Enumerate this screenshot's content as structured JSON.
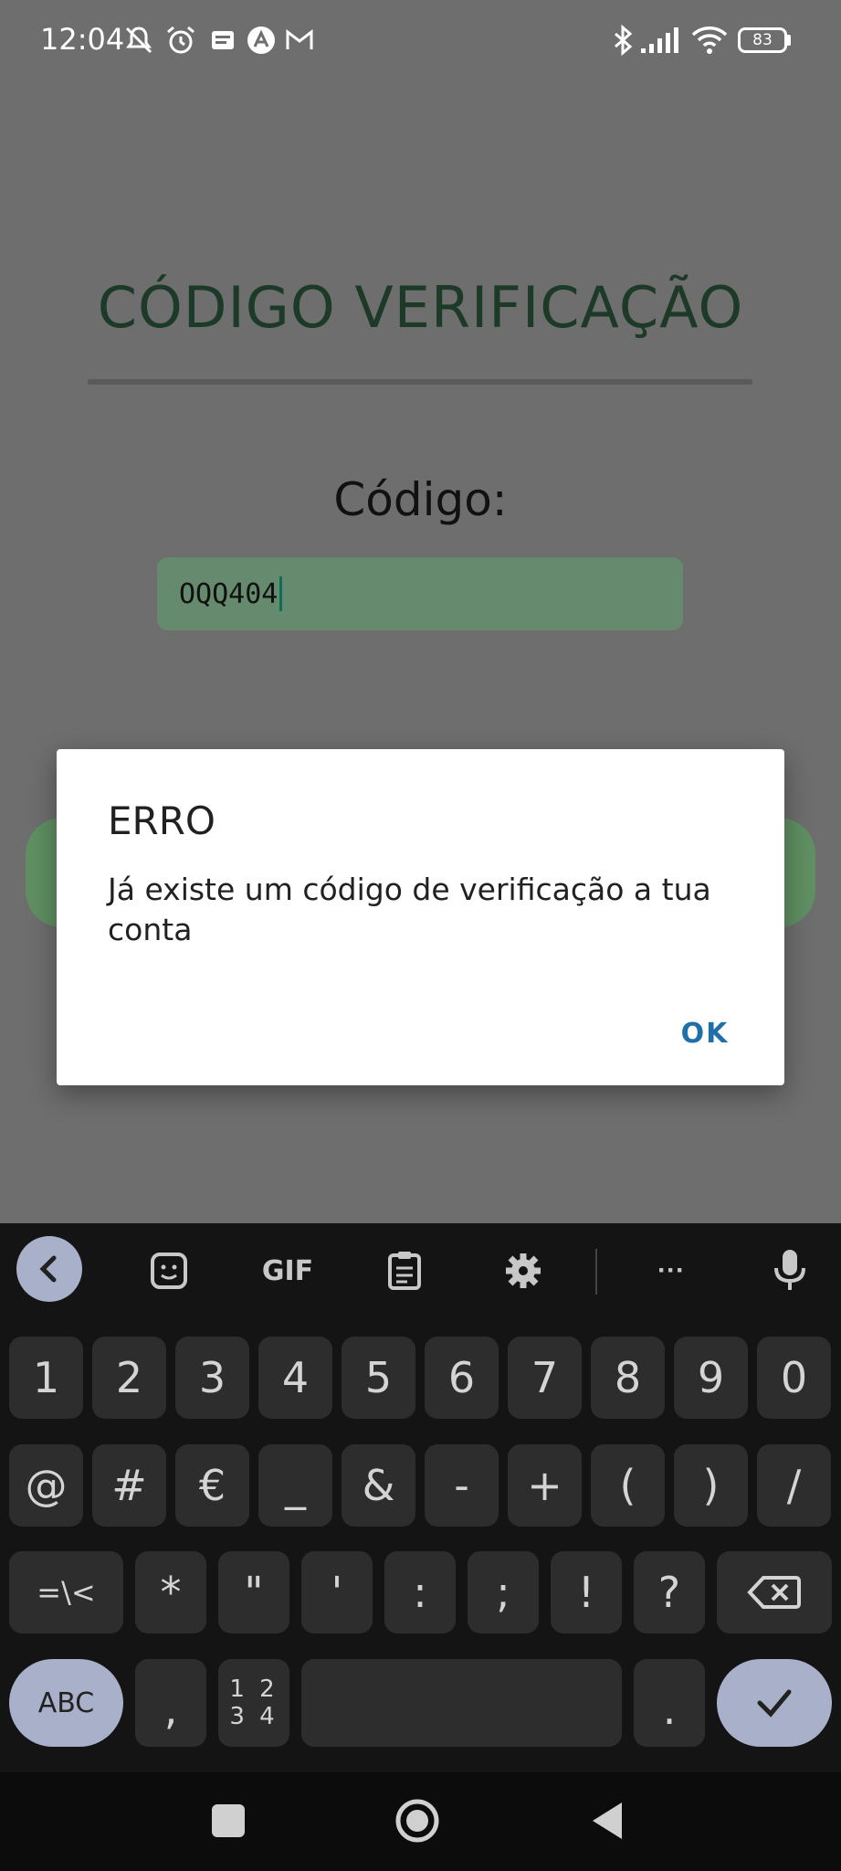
{
  "status_bar": {
    "time": "12:04",
    "battery": "83",
    "left_icons": [
      "mute-icon",
      "alarm-icon",
      "news-icon",
      "app-icon",
      "gmail-icon"
    ],
    "right_icons": [
      "bluetooth-icon",
      "signal-icon",
      "wifi-icon",
      "battery-icon"
    ]
  },
  "page": {
    "title": "CÓDIGO VERIFICAÇÃO",
    "code_label": "Código:",
    "code_value": "OQQ404"
  },
  "dialog": {
    "title": "ERRO",
    "message": "Já existe um código de verificação a tua conta",
    "ok_label": "OK"
  },
  "keyboard": {
    "toolbar": {
      "gif_label": "GIF",
      "more_label": "···",
      "icons": [
        "back-chevron-icon",
        "sticker-icon",
        "gif-icon",
        "clipboard-icon",
        "gear-icon",
        "more-icon",
        "mic-icon"
      ]
    },
    "row1": [
      "1",
      "2",
      "3",
      "4",
      "5",
      "6",
      "7",
      "8",
      "9",
      "0"
    ],
    "row2": [
      "@",
      "#",
      "€",
      "_",
      "&",
      "-",
      "+",
      "(",
      ")",
      "/"
    ],
    "row3": [
      "=\\<",
      "*",
      "\"",
      "'",
      ":",
      ";",
      "!",
      "?"
    ],
    "row4": {
      "abc": "ABC",
      "comma": ",",
      "num_switch_top": "1 2",
      "num_switch_bottom": "3 4",
      "period": "."
    }
  },
  "colors": {
    "title_green": "#1c3a27",
    "input_bg": "#668a6d",
    "ok_blue": "#1f6fa8",
    "keyboard_bg": "#141414",
    "key_bg": "#2d2d2d",
    "accent_key": "#a8b1c9"
  }
}
